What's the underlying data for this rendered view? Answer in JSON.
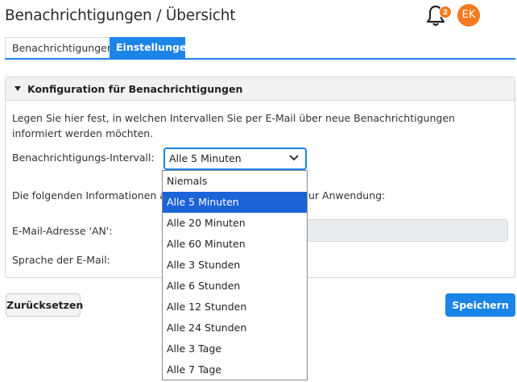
{
  "header": {
    "title": "Benachrichtigungen / Übersicht",
    "notification_count": "2",
    "avatar_initials": "EK",
    "accent": "#f47a20"
  },
  "tabs": [
    {
      "label": "Benachrichtigungen",
      "active": false
    },
    {
      "label": "Einstellungen",
      "active": true
    }
  ],
  "panel": {
    "title": "Konfiguration für Benachrichtigungen",
    "intro": "Legen Sie hier fest, in welchen Intervallen Sie per E-Mail über neue Benachrichtigungen informiert werden möchten.",
    "interval_label": "Benachrichtigungs-Intervall:",
    "interval_value": "Alle 5 Minuten",
    "info_prefix": "Die folgenden Informationen aus",
    "info_suffix": "ur Anwendung:",
    "email_label": "E-Mail-Adresse 'AN':",
    "language_label": "Sprache der E-Mail:"
  },
  "dropdown": {
    "options": [
      "Niemals",
      "Alle 5 Minuten",
      "Alle 20 Minuten",
      "Alle 60 Minuten",
      "Alle 3 Stunden",
      "Alle 6 Stunden",
      "Alle 12 Stunden",
      "Alle 24 Stunden",
      "Alle 3 Tage",
      "Alle 7 Tage"
    ],
    "selected": "Alle 5 Minuten"
  },
  "buttons": {
    "reset": "Zurücksetzen",
    "save": "Speichern"
  },
  "colors": {
    "primary": "#1b84e7",
    "selected_option": "#1b63d6",
    "badge": "#f47a20"
  }
}
